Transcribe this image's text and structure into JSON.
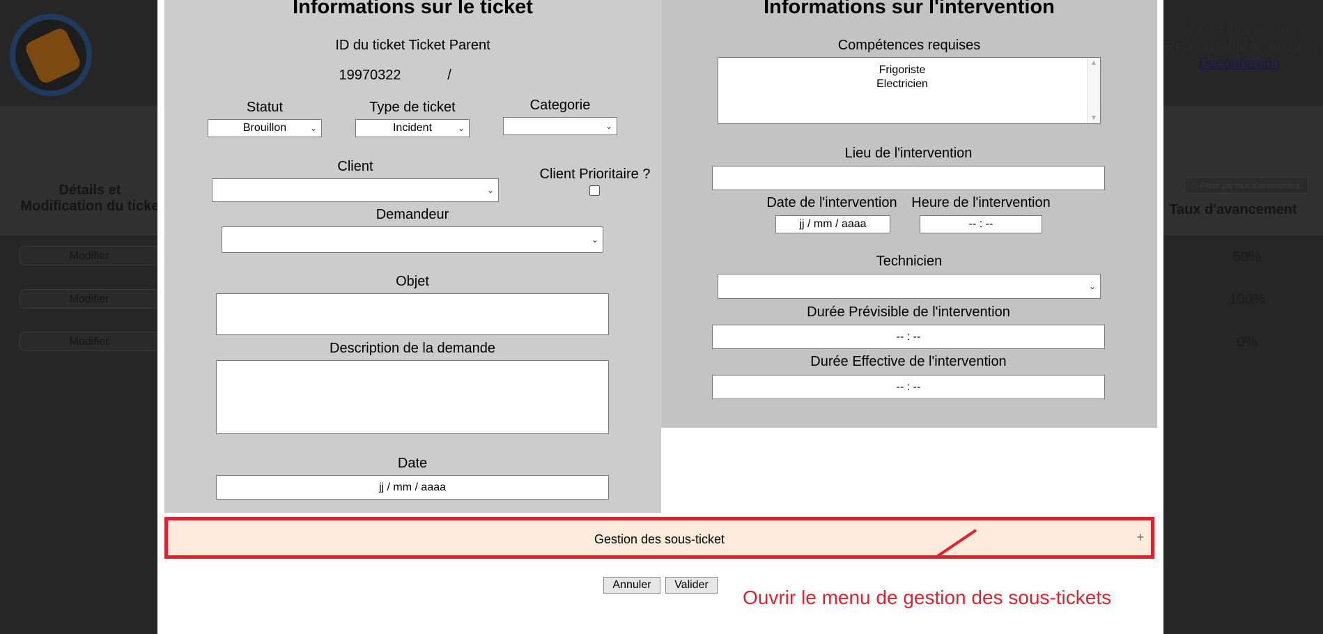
{
  "background": {
    "user_name": "Michel Operandus",
    "user_role": "(Responsable technicien)",
    "logout_label": "Deconnexion",
    "column_left_line1": "Détails et",
    "column_left_line2": "Modification du ticke",
    "column_right": "Taux d'avancement",
    "filter_placeholder": "Filtrer par taux d'avancement",
    "rows": [
      {
        "button": "Modifier",
        "progress": "50%"
      },
      {
        "button": "Modifier",
        "progress": "100%"
      },
      {
        "button": "Modifier",
        "progress": "0%"
      }
    ]
  },
  "ticket": {
    "heading": "Informations sur le ticket",
    "id_label": "ID du ticket Ticket Parent",
    "id_value": "19970322",
    "parent_value": "/",
    "statut_label": "Statut",
    "statut_value": "Brouillon",
    "type_label": "Type de ticket",
    "type_value": "Incident",
    "categorie_label": "Categorie",
    "categorie_value": "",
    "client_label": "Client",
    "client_value": "",
    "prioritaire_label": "Client Prioritaire ?",
    "demandeur_label": "Demandeur",
    "demandeur_value": "",
    "objet_label": "Objet",
    "description_label": "Description de la demande",
    "date_label": "Date",
    "date_placeholder": "jj / mm / aaaa"
  },
  "intervention": {
    "heading": "Informations sur l'intervention",
    "competences_label": "Compétences requises",
    "competences": [
      "Frigoriste",
      "Electricien"
    ],
    "lieu_label": "Lieu de l'intervention",
    "date_label": "Date de l'intervention",
    "date_placeholder": "jj / mm / aaaa",
    "heure_label": "Heure de l'intervention",
    "heure_placeholder": "-- : --",
    "technicien_label": "Technicien",
    "duree_prev_label": "Durée Prévisible de l'intervention",
    "duree_prev_placeholder": "-- : --",
    "duree_eff_label": "Durée Effective de l'intervention",
    "duree_eff_placeholder": "-- : --"
  },
  "accordion": {
    "title": "Gestion des sous-ticket",
    "toggle": "+"
  },
  "actions": {
    "cancel": "Annuler",
    "submit": "Valider"
  },
  "annotation": {
    "text": "Ouvrir le menu de gestion des sous-tickets",
    "color": "#e1222d"
  }
}
